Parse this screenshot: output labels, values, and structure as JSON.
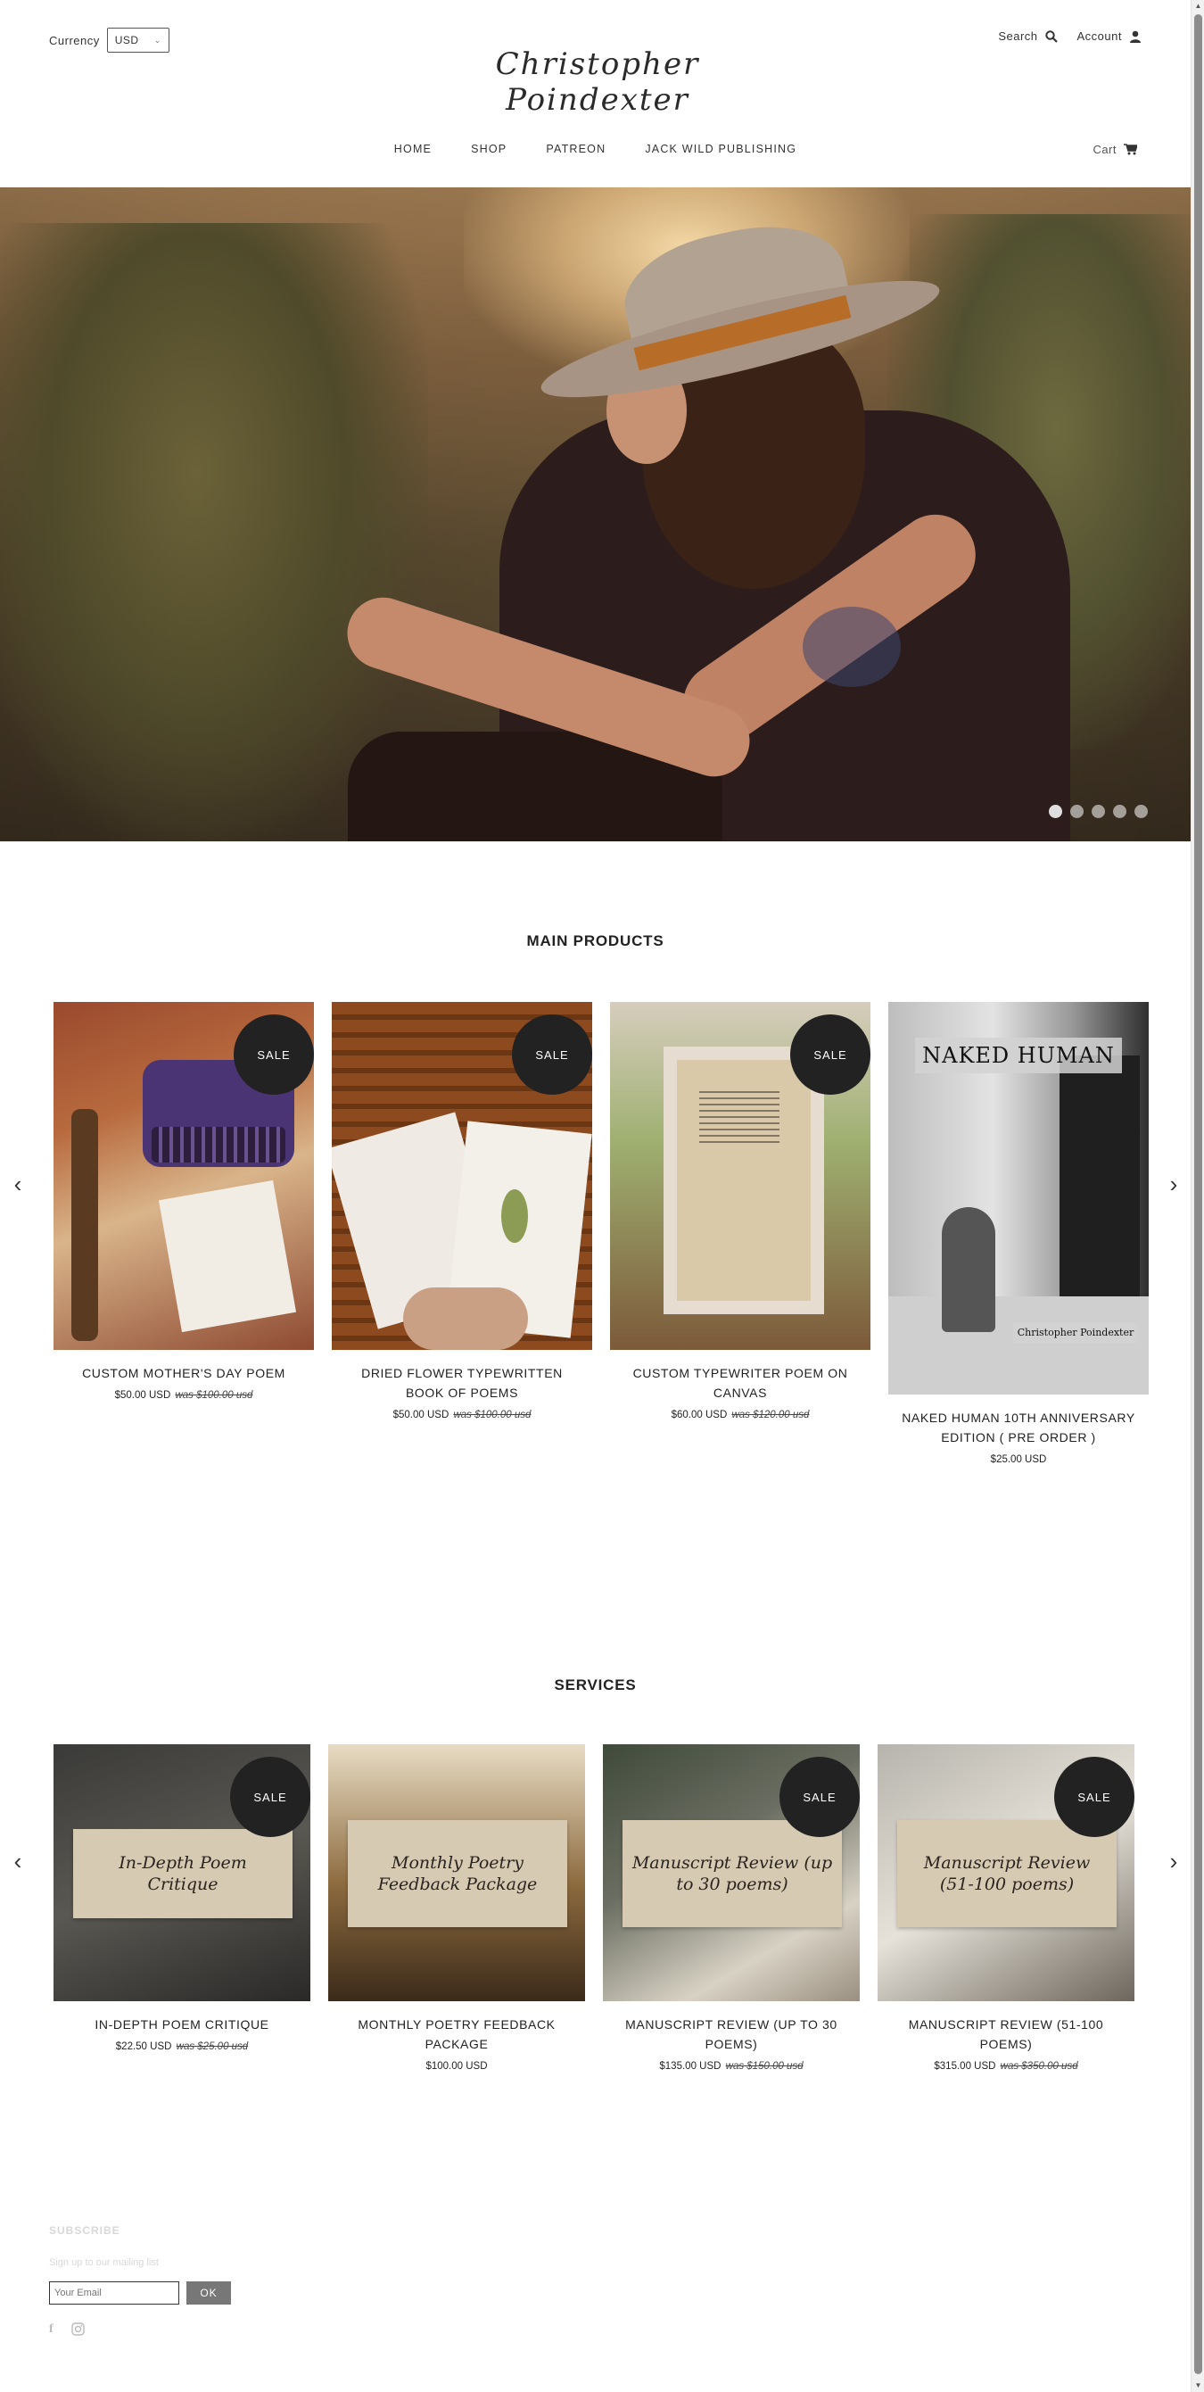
{
  "header": {
    "currency_label": "Currency",
    "currency_value": "USD",
    "brand": "Christopher Poindexter",
    "search_label": "Search",
    "account_label": "Account",
    "cart_label": "Cart"
  },
  "nav": [
    "HOME",
    "SHOP",
    "PATREON",
    "JACK WILD PUBLISHING"
  ],
  "hero": {
    "slides": 5,
    "active_slide": 1
  },
  "main_products": {
    "title": "MAIN PRODUCTS",
    "items": [
      {
        "name": "CUSTOM MOTHER'S DAY POEM",
        "price": "$50.00 USD",
        "was": "was $100.00 usd",
        "badge": "SALE"
      },
      {
        "name": "DRIED FLOWER TYPEWRITTEN BOOK OF POEMS",
        "price": "$50.00 USD",
        "was": "was $100.00 usd",
        "badge": "SALE"
      },
      {
        "name": "CUSTOM TYPEWRITER POEM ON CANVAS",
        "price": "$60.00 USD",
        "was": "was $120.00 usd",
        "badge": "SALE"
      },
      {
        "name": "NAKED HUMAN 10TH ANNIVERSARY EDITION ( PRE ORDER )",
        "price": "$25.00 USD",
        "was": "",
        "cover_title": "NAKED HUMAN",
        "cover_author": "Christopher Poindexter"
      }
    ]
  },
  "services": {
    "title": "SERVICES",
    "items": [
      {
        "name": "IN-DEPTH POEM CRITIQUE",
        "price": "$22.50 USD",
        "was": "was $25.00 usd",
        "badge": "SALE",
        "image_text": "In-Depth Poem Critique"
      },
      {
        "name": "MONTHLY POETRY FEEDBACK PACKAGE",
        "price": "$100.00 USD",
        "was": "",
        "image_text": "Monthly Poetry Feedback Package"
      },
      {
        "name": "MANUSCRIPT REVIEW (UP TO 30 POEMS)",
        "price": "$135.00 USD",
        "was": "was $150.00 usd",
        "badge": "SALE",
        "image_text": "Manuscript Review (up to 30 poems)"
      },
      {
        "name": "MANUSCRIPT REVIEW (51-100 POEMS)",
        "price": "$315.00 USD",
        "was": "was $350.00 usd",
        "badge": "SALE",
        "image_text": "Manuscript Review (51-100 poems)"
      }
    ]
  },
  "footer": {
    "subscribe_title": "SUBSCRIBE",
    "subscribe_sub": "Sign up to our mailing list",
    "email_placeholder": "Your Email",
    "ok_label": "OK"
  },
  "icons": {
    "search": "search-icon",
    "account": "user-icon",
    "cart": "cart-icon",
    "prev": "chevron-left-icon",
    "next": "chevron-right-icon",
    "facebook": "facebook-icon",
    "instagram": "instagram-icon"
  }
}
